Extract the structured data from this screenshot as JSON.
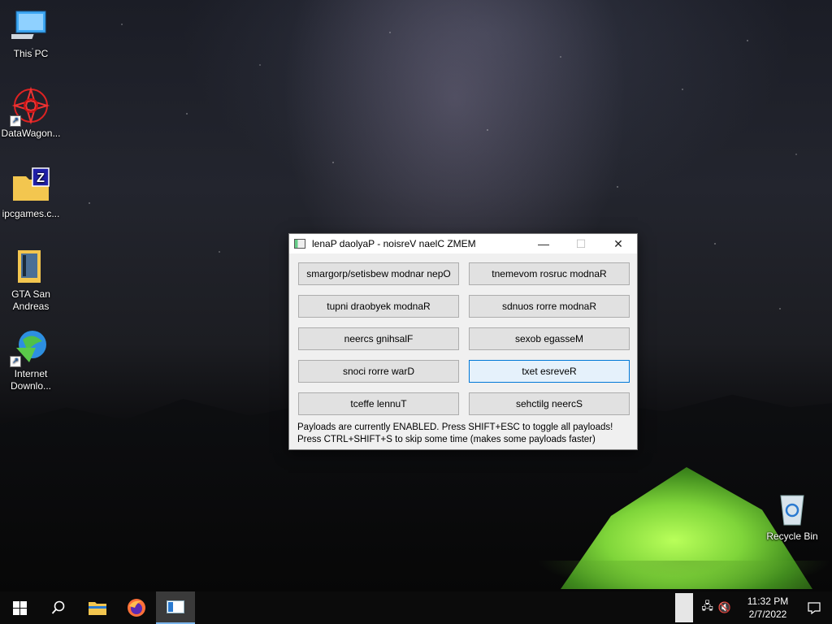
{
  "desktop": {
    "icons": [
      {
        "label": "This PC",
        "icon": "computer-icon"
      },
      {
        "label": "DataWagon...",
        "icon": "datawagon-icon"
      },
      {
        "label": "ipcgames.c...",
        "icon": "zip-folder-icon"
      },
      {
        "label": "GTA San Andreas",
        "icon": "folder-icon"
      },
      {
        "label": "Internet Downlo...",
        "icon": "internet-download-manager-icon"
      },
      {
        "label": "Recycle Bin",
        "icon": "recycle-bin-icon"
      }
    ]
  },
  "dialog": {
    "title": "lenaP daolyaP - noisreV naelC ZMEM",
    "controls": {
      "minimize": "—",
      "maximize": "☐",
      "close": "✕"
    },
    "buttons": [
      "smargorp/setisbew modnar nepO",
      "tnemevom rosruc modnaR",
      "tupni draobyek modnaR",
      "sdnuos rorre modnaR",
      "neercs gnihsalF",
      "sexob egasseM",
      "snoci rorre warD",
      "txet esreveR",
      "tceffe lennuT",
      "sehctilg neercS"
    ],
    "info_line1": "Payloads are currently ENABLED. Press SHIFT+ESC to toggle all payloads!",
    "info_line2": "Press CTRL+SHIFT+S to skip some time (makes some payloads faster)"
  },
  "taskbar": {
    "items": [
      "start-icon",
      "search-icon",
      "file-explorer-icon",
      "firefox-icon",
      "memz-app-icon"
    ],
    "clock_time": "11:32 PM",
    "clock_date": "2/7/2022"
  }
}
